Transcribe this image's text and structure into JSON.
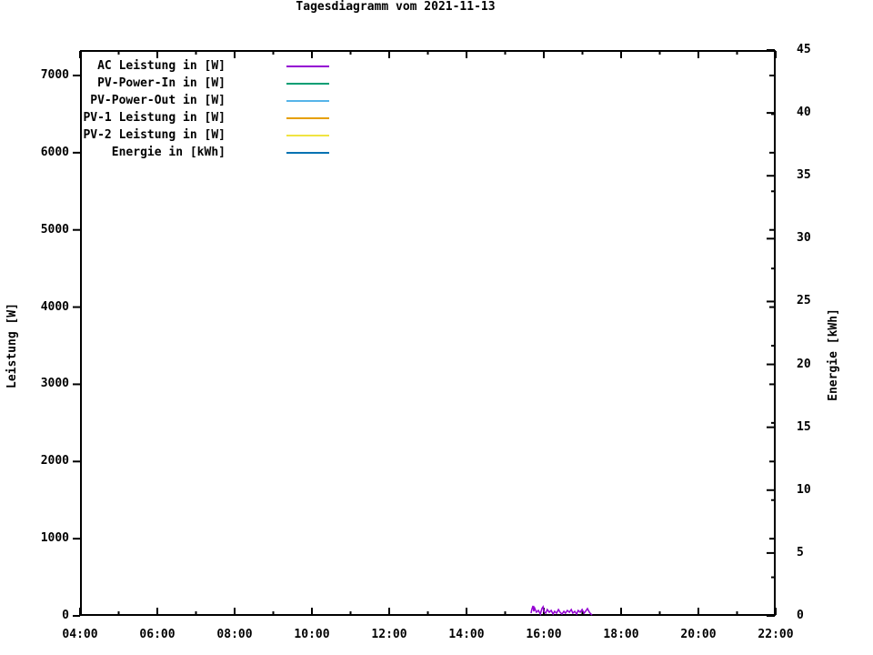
{
  "title": "Tagesdiagramm vom 2021-11-13",
  "axes": {
    "x": {
      "min": 4,
      "max": 22,
      "major_step": 2,
      "minor_step": 1,
      "tick_labels": [
        "04:00",
        "06:00",
        "08:00",
        "10:00",
        "12:00",
        "14:00",
        "16:00",
        "18:00",
        "20:00",
        "22:00"
      ]
    },
    "y1": {
      "label": "Leistung [W]",
      "min": 0,
      "max": 7330,
      "major_step": 1000,
      "minor_step": 500,
      "tick_labels": [
        "0",
        "1000",
        "2000",
        "3000",
        "4000",
        "5000",
        "6000",
        "7000"
      ]
    },
    "y2": {
      "label": "Energie [kWh]",
      "min": 0,
      "max": 45,
      "major_step": 5,
      "minor_step": 2.5,
      "tick_labels": [
        "0",
        "5",
        "10",
        "15",
        "20",
        "25",
        "30",
        "35",
        "40",
        "45"
      ]
    }
  },
  "colors": {
    "foreground": "#000000",
    "background": "#ffffff"
  },
  "chart_data": {
    "type": "line",
    "title": "Tagesdiagramm vom 2021-11-13",
    "xlabel": "",
    "ylabel_left": "Leistung [W]",
    "ylabel_right": "Energie [kWh]",
    "xlim_hours": [
      4,
      22
    ],
    "x_tick_labels": [
      "04:00",
      "06:00",
      "08:00",
      "10:00",
      "12:00",
      "14:00",
      "16:00",
      "18:00",
      "20:00",
      "22:00"
    ],
    "ylim_left": [
      0,
      7330
    ],
    "ylim_right": [
      0,
      45
    ],
    "grid": false,
    "legend_position": "inside top-left",
    "series": [
      {
        "name": "AC Leistung in [W]",
        "axis": "left",
        "color": "#9400d3",
        "points": [
          [
            15.67,
            35
          ],
          [
            15.69,
            82
          ],
          [
            15.72,
            130
          ],
          [
            15.74,
            59
          ],
          [
            15.76,
            106
          ],
          [
            15.81,
            47
          ],
          [
            15.86,
            71
          ],
          [
            15.91,
            24
          ],
          [
            15.95,
            94
          ],
          [
            15.98,
            118
          ],
          [
            16.0,
            59
          ],
          [
            16.05,
            35
          ],
          [
            16.09,
            82
          ],
          [
            16.14,
            47
          ],
          [
            16.19,
            71
          ],
          [
            16.24,
            24
          ],
          [
            16.28,
            59
          ],
          [
            16.33,
            35
          ],
          [
            16.38,
            82
          ],
          [
            16.42,
            47
          ],
          [
            16.47,
            24
          ],
          [
            16.52,
            59
          ],
          [
            16.56,
            35
          ],
          [
            16.61,
            71
          ],
          [
            16.66,
            47
          ],
          [
            16.71,
            82
          ],
          [
            16.75,
            35
          ],
          [
            16.8,
            59
          ],
          [
            16.85,
            24
          ],
          [
            16.89,
            71
          ],
          [
            16.94,
            47
          ],
          [
            16.99,
            82
          ],
          [
            17.04,
            35
          ],
          [
            17.08,
            59
          ],
          [
            17.13,
            94
          ],
          [
            17.18,
            47
          ],
          [
            17.22,
            24
          ],
          [
            17.25,
            12
          ]
        ]
      },
      {
        "name": "PV-Power-In in [W]",
        "axis": "left",
        "color": "#009e73",
        "points": []
      },
      {
        "name": "PV-Power-Out in [W]",
        "axis": "left",
        "color": "#56b4e9",
        "points": []
      },
      {
        "name": "PV-1 Leistung in [W]",
        "axis": "left",
        "color": "#e69f00",
        "points": []
      },
      {
        "name": "PV-2 Leistung in [W]",
        "axis": "left",
        "color": "#f0e442",
        "points": []
      },
      {
        "name": "Energie in [kWh]",
        "axis": "right",
        "color": "#0072b2",
        "points": []
      }
    ]
  }
}
